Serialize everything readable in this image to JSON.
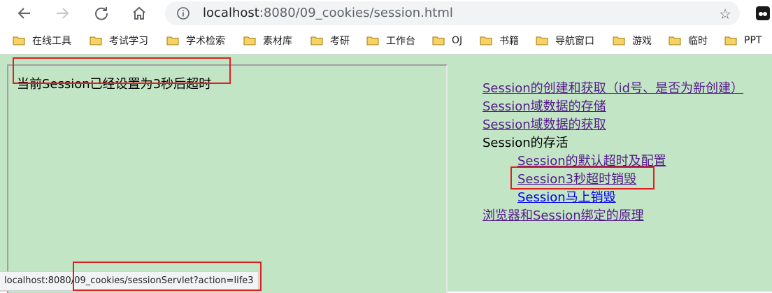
{
  "toolbar": {
    "back_icon": "back-arrow-icon",
    "forward_icon": "forward-arrow-icon",
    "reload_icon": "reload-icon",
    "home_icon": "home-icon",
    "url_host": "localhost",
    "url_rest": ":8080/09_cookies/session.html",
    "star_icon": "star-icon"
  },
  "bookmarks": [
    {
      "label": "在线工具"
    },
    {
      "label": "考试学习"
    },
    {
      "label": "学术检索"
    },
    {
      "label": "素材库"
    },
    {
      "label": "考研"
    },
    {
      "label": "工作台"
    },
    {
      "label": "OJ"
    },
    {
      "label": "书籍"
    },
    {
      "label": "导航窗口"
    },
    {
      "label": "游戏"
    },
    {
      "label": "临时"
    },
    {
      "label": "PPT"
    }
  ],
  "left_frame": {
    "message": "当前Session已经设置为3秒后超时"
  },
  "nav": {
    "item1": "Session的创建和获取（id号、是否为新创建）",
    "item2": "Session域数据的存储",
    "item3": "Session域数据的获取",
    "item4": "Session的存活",
    "item5": "Session的默认超时及配置",
    "item6": "Session3秒超时销毁",
    "item7": "Session马上销毁",
    "item8": "浏览器和Session绑定的原理"
  },
  "status_bar": {
    "url": "localhost:8080/09_cookies/sessionServlet?action=life3"
  },
  "colors": {
    "page_bg": "#c2e6c5",
    "visited_link": "#551a8b",
    "unvisited_link": "#0000ee",
    "highlight": "#e02020"
  }
}
